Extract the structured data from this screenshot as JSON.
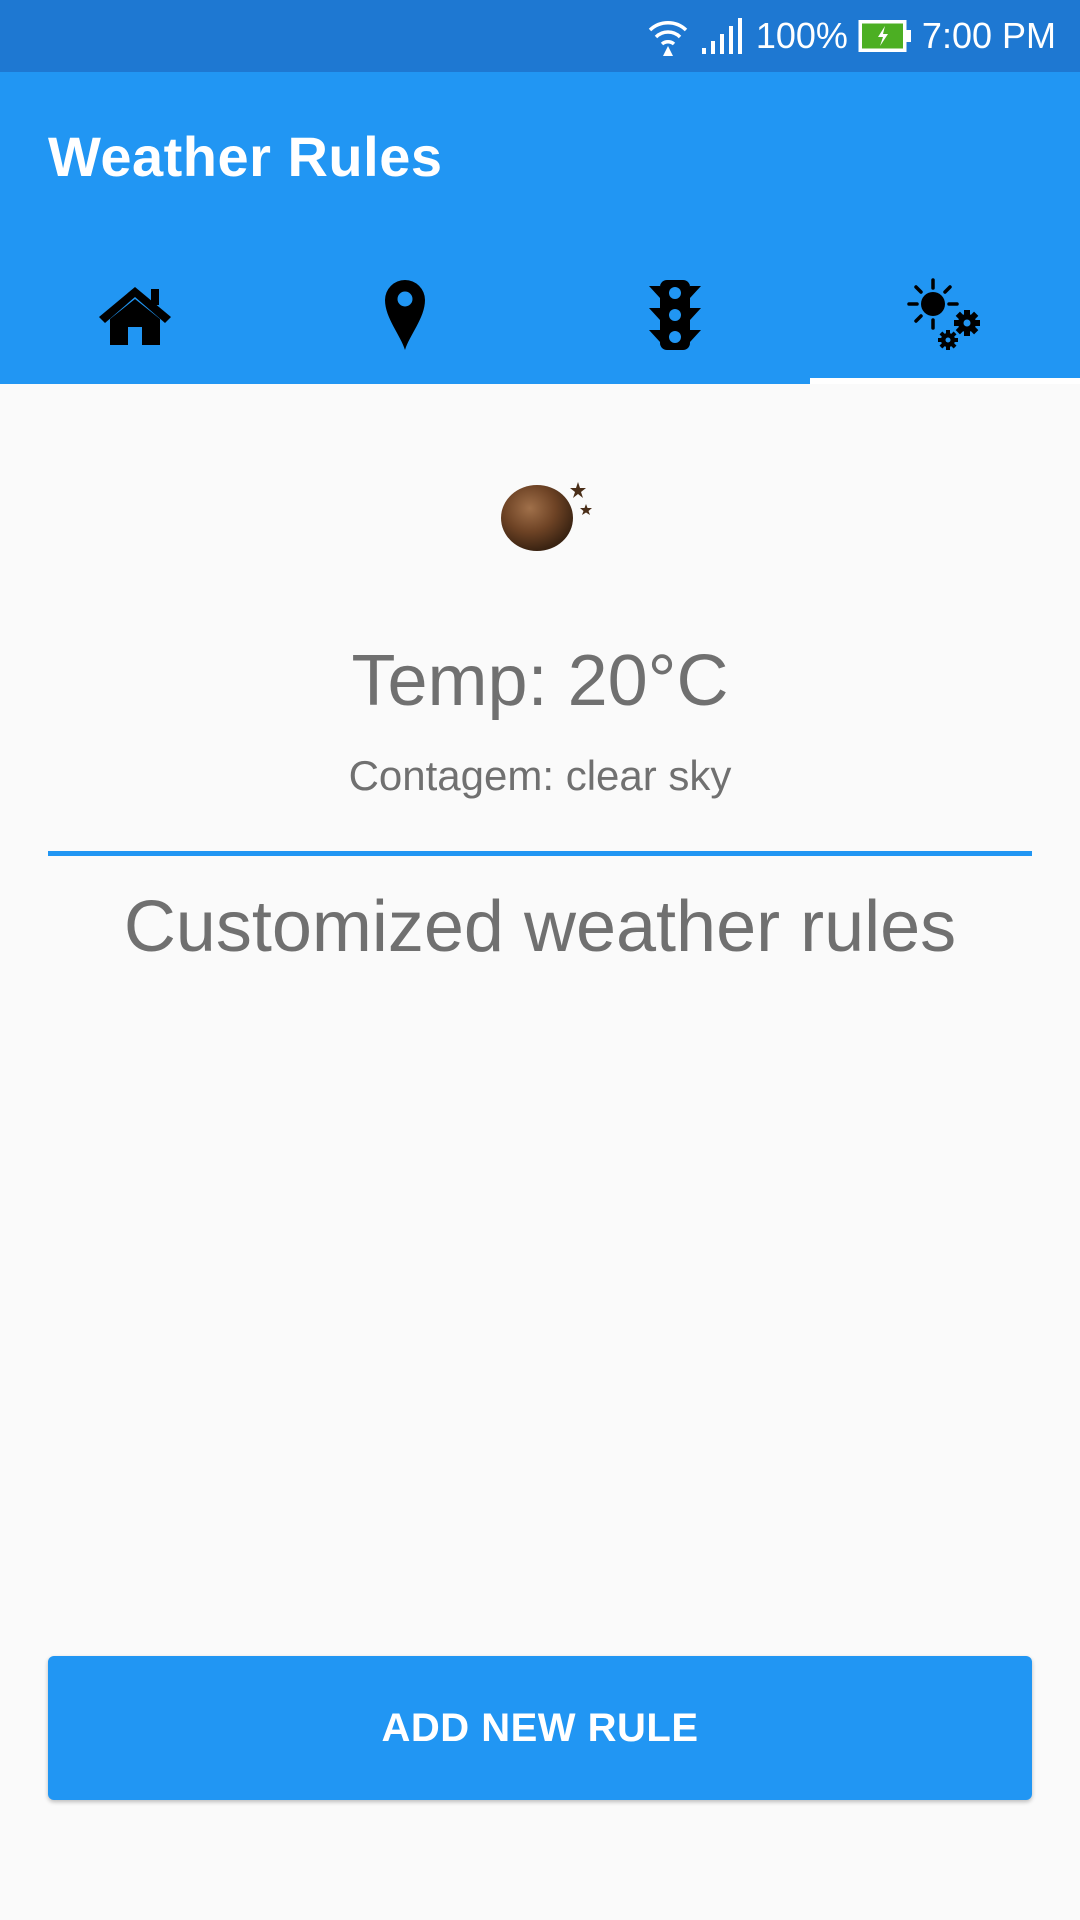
{
  "status_bar": {
    "wifi_icon": "wifi-icon",
    "signal_icon": "signal-icon",
    "battery_percent": "100%",
    "battery_icon": "battery-charging-icon",
    "time": "7:00 PM"
  },
  "app_bar": {
    "title": "Weather Rules",
    "tabs": [
      {
        "icon": "home-icon",
        "active": false
      },
      {
        "icon": "location-pin-icon",
        "active": false
      },
      {
        "icon": "traffic-light-icon",
        "active": false
      },
      {
        "icon": "weather-settings-icon",
        "active": true
      }
    ]
  },
  "weather": {
    "icon": "night-clear-sky-icon",
    "temperature": "Temp: 20°C",
    "description": "Contagem: clear sky"
  },
  "rules": {
    "title": "Customized weather rules",
    "items": []
  },
  "actions": {
    "add_rule_label": "ADD NEW RULE"
  },
  "colors": {
    "status_bar": "#1e78d2",
    "primary": "#2196f3",
    "text_secondary": "#707070",
    "background": "#fafafa"
  }
}
